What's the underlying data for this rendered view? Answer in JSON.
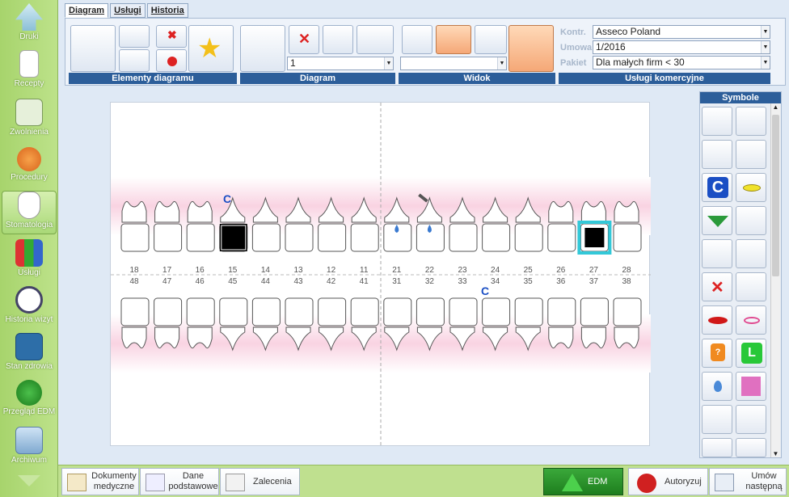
{
  "sidebar": {
    "items": [
      {
        "label": "Druki",
        "icon": "printer-icon"
      },
      {
        "label": "Recepty",
        "icon": "prescription-icon"
      },
      {
        "label": "Zwolnienia",
        "icon": "sick-leave-icon"
      },
      {
        "label": "Procedury",
        "icon": "icd-icon"
      },
      {
        "label": "Stomatologia",
        "icon": "tooth-icon"
      },
      {
        "label": "Usługi",
        "icon": "services-icon"
      },
      {
        "label": "Historia wizyt",
        "icon": "clock-icon"
      },
      {
        "label": "Stan zdrowia",
        "icon": "health-chart-icon"
      },
      {
        "label": "Przegląd EDM",
        "icon": "edm-icon"
      },
      {
        "label": "Archiwum",
        "icon": "archive-icon"
      }
    ]
  },
  "tabs": [
    "Diagram",
    "Usługi",
    "Historia"
  ],
  "ribbon": {
    "sections": [
      "Elementy diagramu",
      "Diagram",
      "Widok",
      "Usługi komercyjne"
    ],
    "diagram_select": "1",
    "view_select": "",
    "fields": {
      "kontr_label": "Kontr.",
      "kontr_value": "Asseco Poland",
      "umowa_label": "Umowa",
      "umowa_value": "1/2016",
      "pakiet_label": "Pakiet",
      "pakiet_value": "Dla małych firm < 30"
    }
  },
  "teeth": {
    "upper_numbers": [
      "18",
      "17",
      "16",
      "15",
      "14",
      "13",
      "12",
      "11",
      "21",
      "22",
      "23",
      "24",
      "25",
      "26",
      "27",
      "28"
    ],
    "lower_numbers": [
      "48",
      "47",
      "46",
      "45",
      "44",
      "43",
      "42",
      "41",
      "31",
      "32",
      "33",
      "34",
      "35",
      "36",
      "37",
      "38"
    ],
    "upper_c_marker": "C",
    "lower_c_marker": "C"
  },
  "symbols": {
    "title": "Symbole"
  },
  "bottom": {
    "dokumenty": "Dokumenty medyczne",
    "dane": "Dane podstawowe",
    "zalecenia": "Zalecenia",
    "edm": "EDM",
    "autoryzuj": "Autoryzuj",
    "umow": "Umów następną"
  },
  "colors": {
    "section": "#2c5e9a",
    "sidebar": "#a7d46c",
    "selected_tooth": "#33c8d8"
  }
}
